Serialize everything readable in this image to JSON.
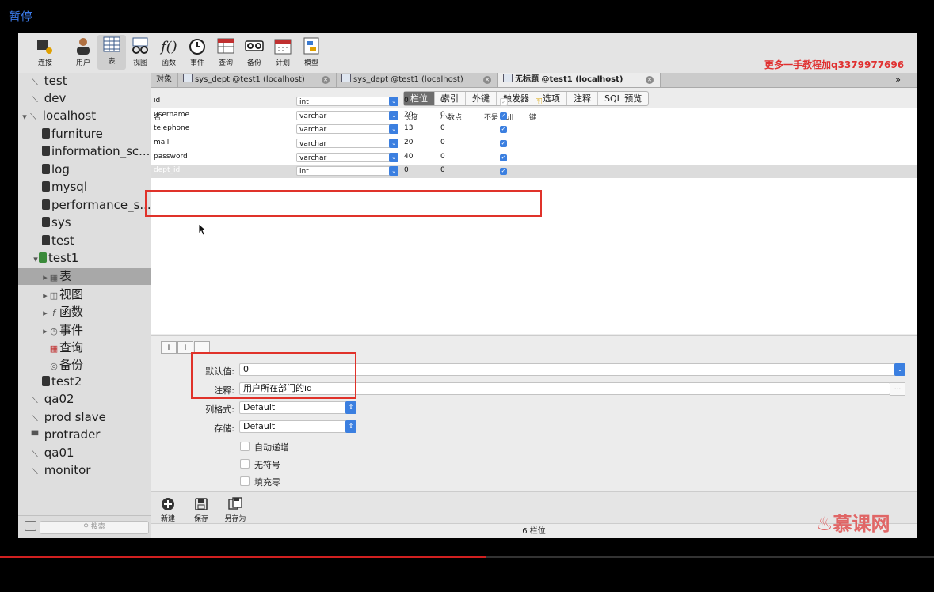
{
  "overlay": {
    "pause_label": "暂停",
    "watermark": "更多一手教程加q3379977696",
    "brand": "慕课网",
    "progress": 0.52
  },
  "toolbar": {
    "items": [
      {
        "label": "连接",
        "icon": "connect-icon"
      },
      {
        "label": "用户",
        "icon": "user-icon"
      },
      {
        "label": "表",
        "icon": "table-icon"
      },
      {
        "label": "视图",
        "icon": "view-icon"
      },
      {
        "label": "函数",
        "icon": "function-icon"
      },
      {
        "label": "事件",
        "icon": "event-icon"
      },
      {
        "label": "查询",
        "icon": "query-icon"
      },
      {
        "label": "备份",
        "icon": "backup-icon"
      },
      {
        "label": "计划",
        "icon": "schedule-icon"
      },
      {
        "label": "模型",
        "icon": "model-icon"
      }
    ]
  },
  "sidebar": {
    "items": [
      {
        "label": "test"
      },
      {
        "label": "dev"
      },
      {
        "label": "localhost"
      },
      {
        "label": "furniture"
      },
      {
        "label": "information_sc..."
      },
      {
        "label": "log"
      },
      {
        "label": "mysql"
      },
      {
        "label": "performance_s..."
      },
      {
        "label": "sys"
      },
      {
        "label": "test"
      },
      {
        "label": "test1"
      },
      {
        "label": "表"
      },
      {
        "label": "视图"
      },
      {
        "label": "函数"
      },
      {
        "label": "事件"
      },
      {
        "label": "查询"
      },
      {
        "label": "备份"
      },
      {
        "label": "test2"
      },
      {
        "label": "qa02"
      },
      {
        "label": "prod slave"
      },
      {
        "label": "protrader"
      },
      {
        "label": "qa01"
      },
      {
        "label": "monitor"
      }
    ],
    "search_placeholder": "搜索"
  },
  "tabs": {
    "objects_label": "对象",
    "items": [
      {
        "label": "sys_dept @test1 (localhost)"
      },
      {
        "label": "sys_dept @test1 (localhost)"
      },
      {
        "label": "无标题 @test1 (localhost)"
      }
    ],
    "more": "»"
  },
  "segments": {
    "items": [
      "栏位",
      "索引",
      "外键",
      "触发器",
      "选项",
      "注释",
      "SQL 预览"
    ]
  },
  "grid": {
    "headers": {
      "name": "名",
      "type": "类型",
      "length": "长度",
      "decimals": "小数点",
      "not_null": "不是 null",
      "key": "键"
    },
    "rows": [
      {
        "name": "id",
        "type": "int",
        "length": "0",
        "decimals": "0",
        "not_null": true,
        "key": true
      },
      {
        "name": "username",
        "type": "varchar",
        "length": "20",
        "decimals": "0",
        "not_null": true,
        "key": false
      },
      {
        "name": "telephone",
        "type": "varchar",
        "length": "13",
        "decimals": "0",
        "not_null": true,
        "key": false
      },
      {
        "name": "mail",
        "type": "varchar",
        "length": "20",
        "decimals": "0",
        "not_null": true,
        "key": false
      },
      {
        "name": "password",
        "type": "varchar",
        "length": "40",
        "decimals": "0",
        "not_null": true,
        "key": false
      },
      {
        "name": "dept_id",
        "type": "int",
        "length": "0",
        "decimals": "0",
        "not_null": true,
        "key": false
      }
    ]
  },
  "props": {
    "add": "+",
    "insert": "+",
    "remove": "−",
    "default_label": "默认值:",
    "default_value": "0",
    "comment_label": "注释:",
    "comment_value": "用户所在部门的id",
    "comment_more": "...",
    "format_label": "列格式:",
    "format_value": "Default",
    "storage_label": "存储:",
    "storage_value": "Default",
    "auto_increment": "自动递增",
    "unsigned": "无符号",
    "zerofill": "填充零"
  },
  "bottom": {
    "new": "新建",
    "save": "保存",
    "save_as": "另存为"
  },
  "status": {
    "text": "6 栏位"
  }
}
